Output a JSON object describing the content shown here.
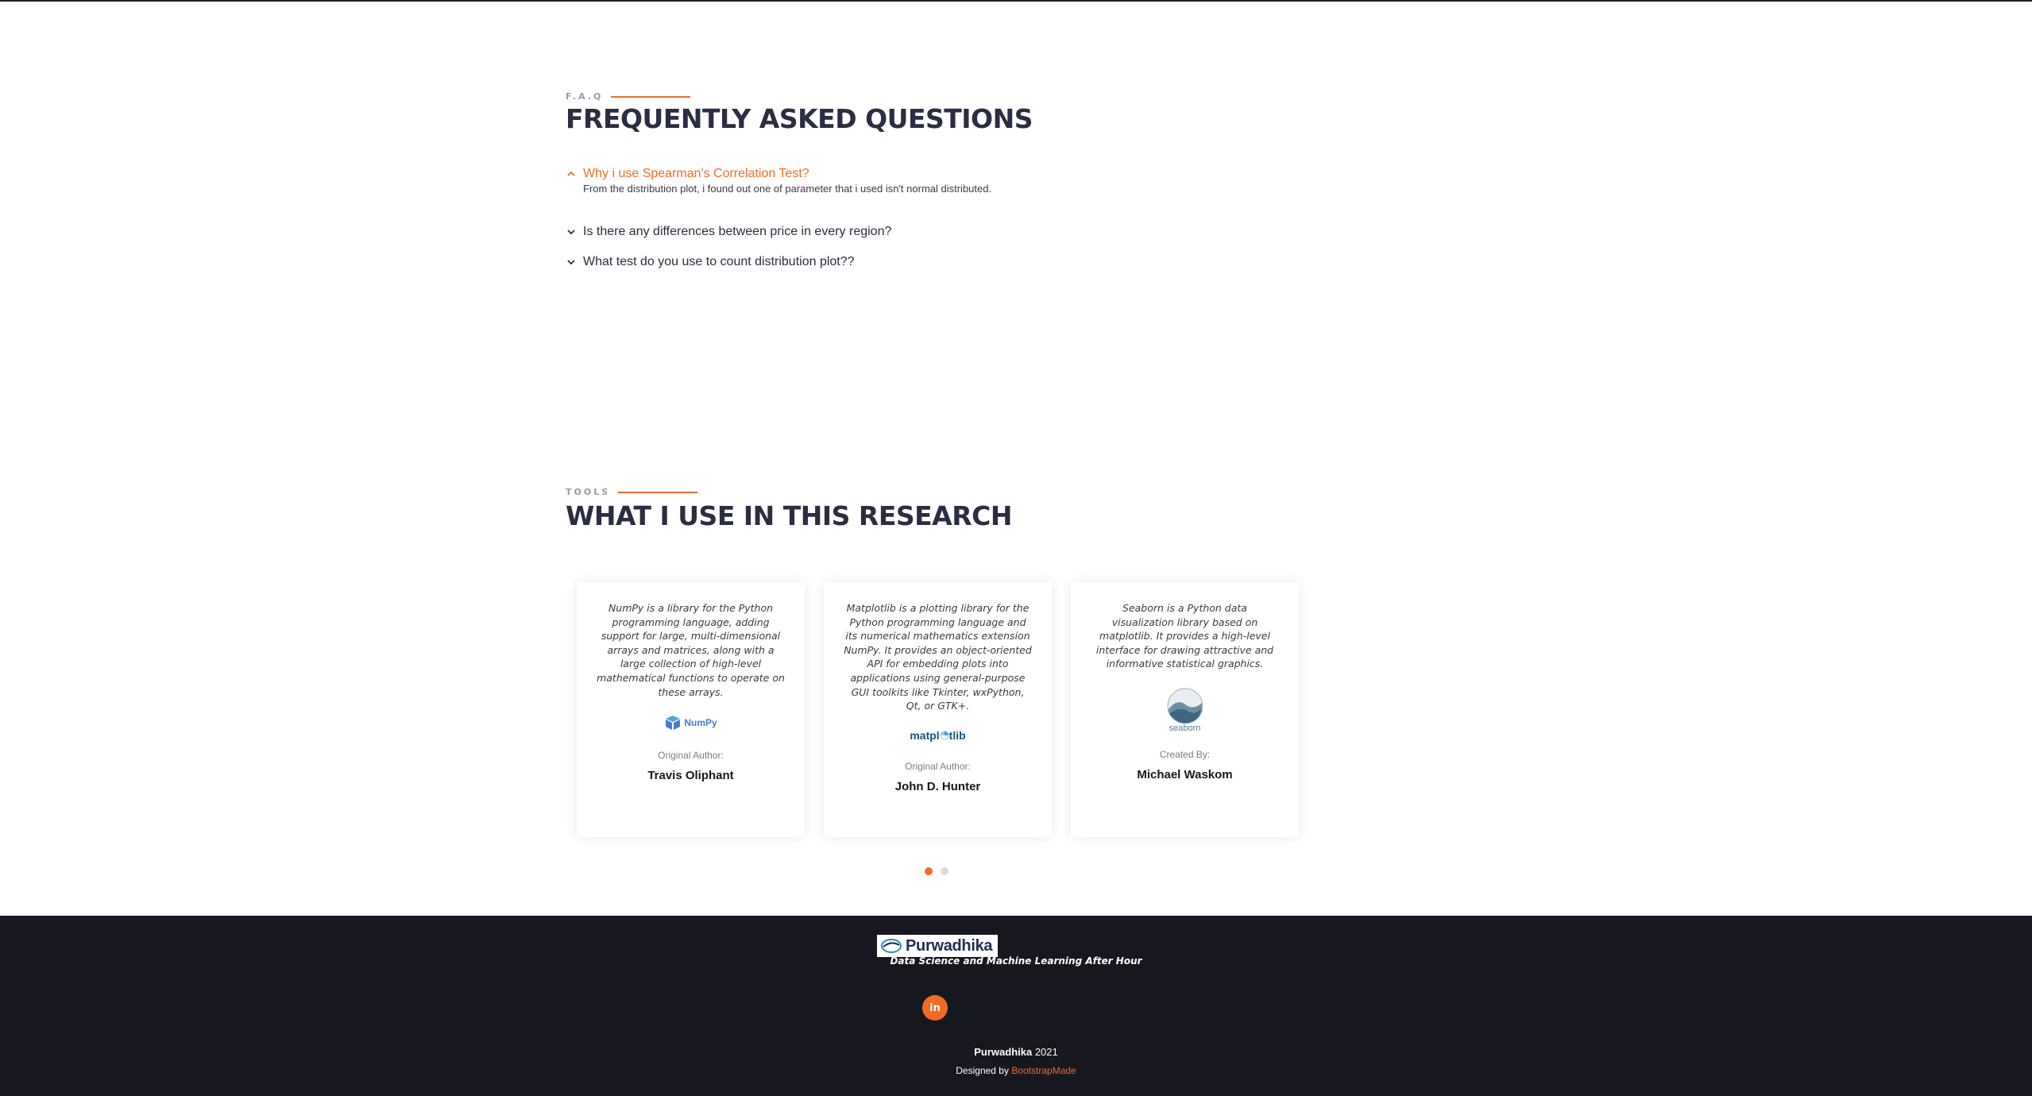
{
  "faq": {
    "subtitle": "F.A.Q",
    "title": "FREQUENTLY ASKED QUESTIONS",
    "items": [
      {
        "question": "Why i use Spearman's Correlation Test?",
        "answer": "From the distribution plot, i found out one of parameter that i used isn't normal distributed.",
        "expanded": true
      },
      {
        "question": "Is there any differences between price in every region?",
        "expanded": false
      },
      {
        "question": "What test do you use to count distribution plot??",
        "expanded": false
      }
    ]
  },
  "tools": {
    "subtitle": "TOOLS",
    "title": "WHAT I USE IN THIS RESEARCH",
    "cards": [
      {
        "description": "NumPy is a library for the Python programming language, adding support for large, multi-dimensional arrays and matrices, along with a large collection of high-level mathematical functions to operate on these arrays.",
        "logo_text": "NumPy",
        "role": "Original Author:",
        "author": "Travis Oliphant"
      },
      {
        "description": "Matplotlib is a plotting library for the Python programming language and its numerical mathematics extension NumPy. It provides an object-oriented API for embedding plots into applications using general-purpose GUI toolkits like Tkinter, wxPython, Qt, or GTK+.",
        "logo_text_a": "matpl",
        "logo_text_b": "tlib",
        "role": "Original Author:",
        "author": "John D. Hunter"
      },
      {
        "description": "Seaborn is a Python data visualization library based on matplotlib. It provides a high-level interface for drawing attractive and informative statistical graphics.",
        "logo_text": "seaborn",
        "role": "Created By:",
        "author": "Michael Waskom"
      }
    ],
    "pagination": {
      "pages": 2,
      "active": 1
    }
  },
  "footer": {
    "logo_text": "Purwadhika",
    "tagline": "Data Science and Machine Learning After Hour",
    "social": "in",
    "copyright_brand": "Purwadhika",
    "copyright_year": "2021",
    "designed_by": "Designed by",
    "designer": "BootstrapMade"
  },
  "colors": {
    "accent": "#f26b25",
    "heading": "#2b2d42",
    "footer_bg": "#17171f"
  }
}
